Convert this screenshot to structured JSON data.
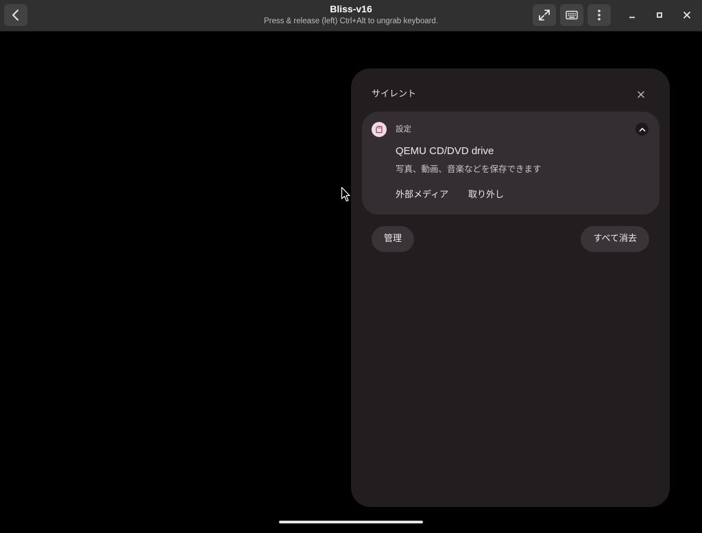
{
  "window": {
    "title": "Bliss-v16",
    "subtitle": "Press & release (left) Ctrl+Alt to ungrab keyboard."
  },
  "titlebar_icons": {
    "back": "chevron-left-icon",
    "fullscreen": "expand-arrows-icon",
    "keyboard": "keyboard-icon",
    "menu": "kebab-menu-icon",
    "minimize": "minimize-icon",
    "maximize": "maximize-icon",
    "close": "close-icon"
  },
  "shade": {
    "heading": "サイレント",
    "close_icon": "close-icon"
  },
  "notification": {
    "app_name": "設定",
    "app_icon": "sd-card-icon",
    "title": "QEMU CD/DVD drive",
    "text": "写真、動画、音楽などを保存できます",
    "actions": [
      "外部メディア",
      "取り外し"
    ],
    "expand_icon": "chevron-up-icon"
  },
  "footer": {
    "manage_label": "管理",
    "clear_all_label": "すべて消去"
  },
  "colors": {
    "titlebar": "#303030",
    "shade_bg": "#221e20",
    "card_bg": "#342d31",
    "button_bg": "#3a3337",
    "app_icon_bg": "#f2d9e6",
    "app_icon_fg": "#8a3a63"
  }
}
